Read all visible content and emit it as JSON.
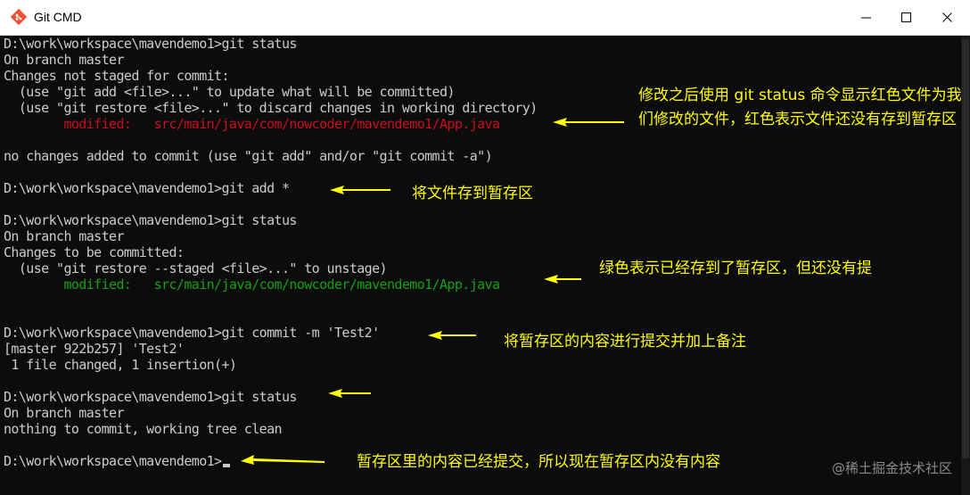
{
  "window": {
    "title": "Git CMD"
  },
  "terminal": {
    "lines": [
      {
        "text": "D:\\work\\workspace\\mavendemo1>git status"
      },
      {
        "text": "On branch master"
      },
      {
        "text": "Changes not staged for commit:"
      },
      {
        "text": "  (use \"git add <file>...\" to update what will be committed)"
      },
      {
        "text": "  (use \"git restore <file>...\" to discard changes in working directory)"
      },
      {
        "text": "        modified:   src/main/java/com/nowcoder/mavendemo1/App.java"
      },
      {
        "text": ""
      },
      {
        "text": "no changes added to commit (use \"git add\" and/or \"git commit -a\")"
      },
      {
        "text": ""
      },
      {
        "text": "D:\\work\\workspace\\mavendemo1>git add *"
      },
      {
        "text": ""
      },
      {
        "text": "D:\\work\\workspace\\mavendemo1>git status"
      },
      {
        "text": "On branch master"
      },
      {
        "text": "Changes to be committed:"
      },
      {
        "text": "  (use \"git restore --staged <file>...\" to unstage)"
      },
      {
        "text": "        modified:   src/main/java/com/nowcoder/mavendemo1/App.java"
      },
      {
        "text": ""
      },
      {
        "text": ""
      },
      {
        "text": "D:\\work\\workspace\\mavendemo1>git commit -m 'Test2'"
      },
      {
        "text": "[master 922b257] 'Test2'"
      },
      {
        "text": " 1 file changed, 1 insertion(+)"
      },
      {
        "text": ""
      },
      {
        "text": "D:\\work\\workspace\\mavendemo1>git status"
      },
      {
        "text": "On branch master"
      },
      {
        "text": "nothing to commit, working tree clean"
      },
      {
        "text": ""
      },
      {
        "text": "D:\\work\\workspace\\mavendemo1>"
      }
    ]
  },
  "annotations": [
    {
      "text": "修改之后使用 git status 命令显示红色文件为我们修改的文件，红色表示文件还没有存到暂存区"
    },
    {
      "text": "将文件存到暂存区"
    },
    {
      "text": "绿色表示已经存到了暂存区，但还没有提"
    },
    {
      "text": "将暂存区的内容进行提交并加上备注"
    },
    {
      "text": "暂存区里的内容已经提交，所以现在暂存区内没有内容"
    }
  ],
  "watermark": "@稀土掘金技术社区",
  "colors": {
    "modified_unstaged": "#c50f1f",
    "modified_staged": "#13a10e",
    "annotation": "#ffff00"
  }
}
